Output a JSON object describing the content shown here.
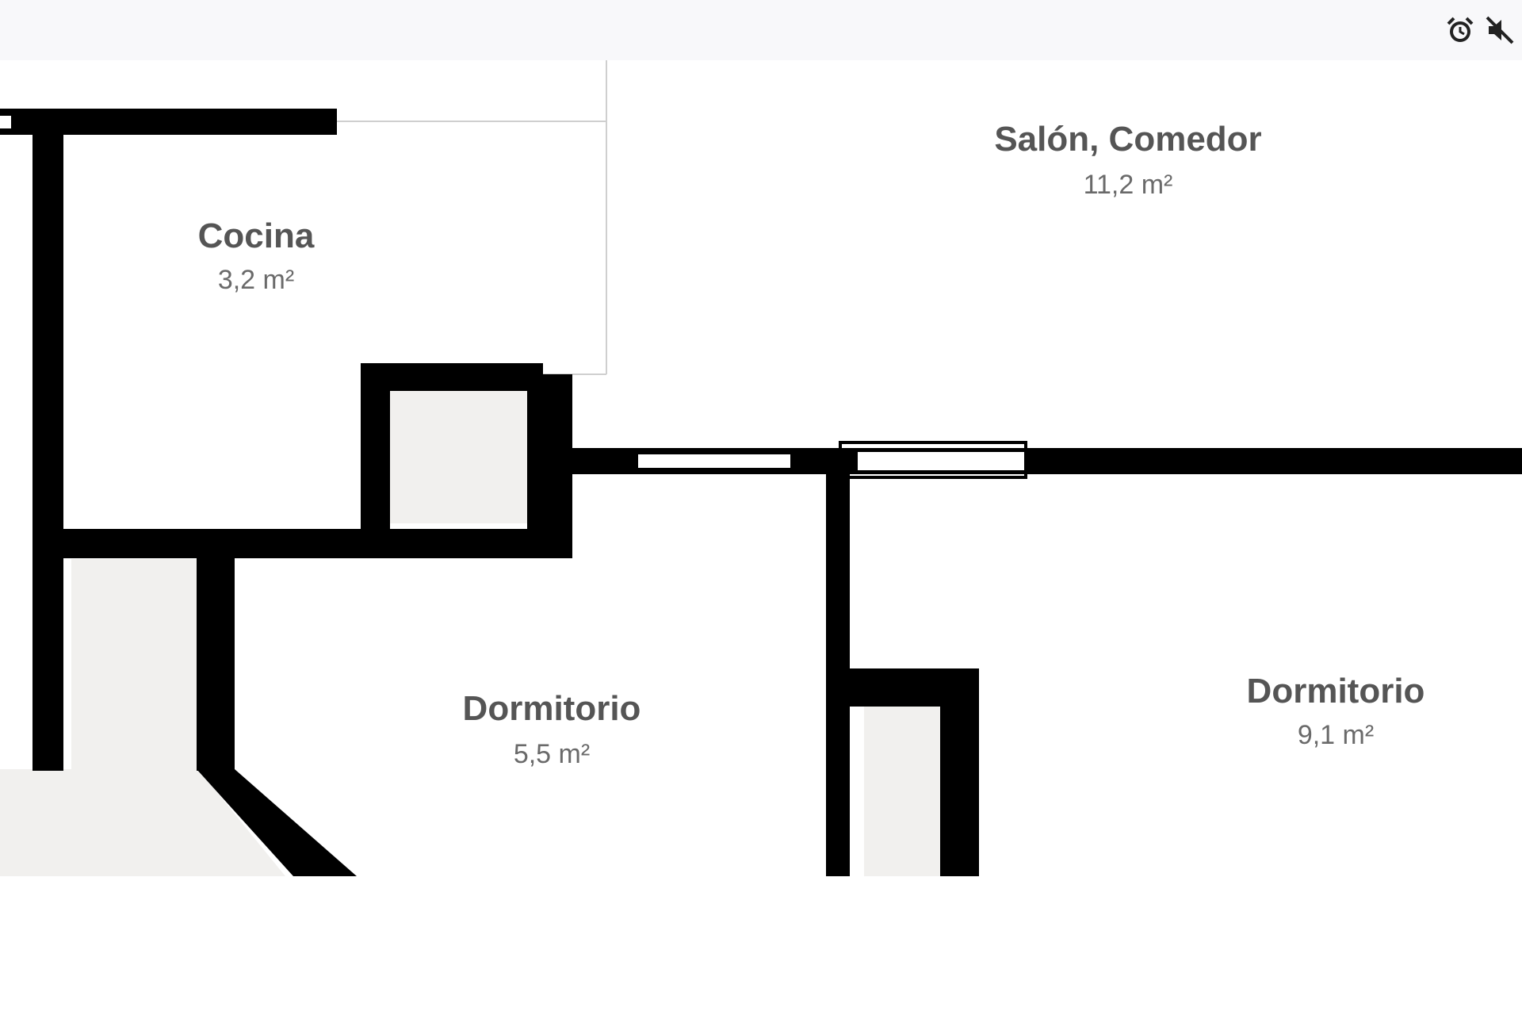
{
  "floor_plan": {
    "rooms": [
      {
        "id": "cocina",
        "name": "Cocina",
        "area": "3,2 m²"
      },
      {
        "id": "salon",
        "name": "Salón, Comedor",
        "area": "11,2 m²"
      },
      {
        "id": "dormitorio-1",
        "name": "Dormitorio",
        "area": "5,5 m²"
      },
      {
        "id": "dormitorio-2",
        "name": "Dormitorio",
        "area": "9,1 m²"
      }
    ],
    "colors": {
      "wall": "#000000",
      "floor_fill": "#f1f0ee",
      "background": "#ffffff",
      "label": "#555555"
    }
  },
  "status_bar": {
    "icons": [
      "alarm-clock-icon",
      "mute-icon"
    ]
  }
}
